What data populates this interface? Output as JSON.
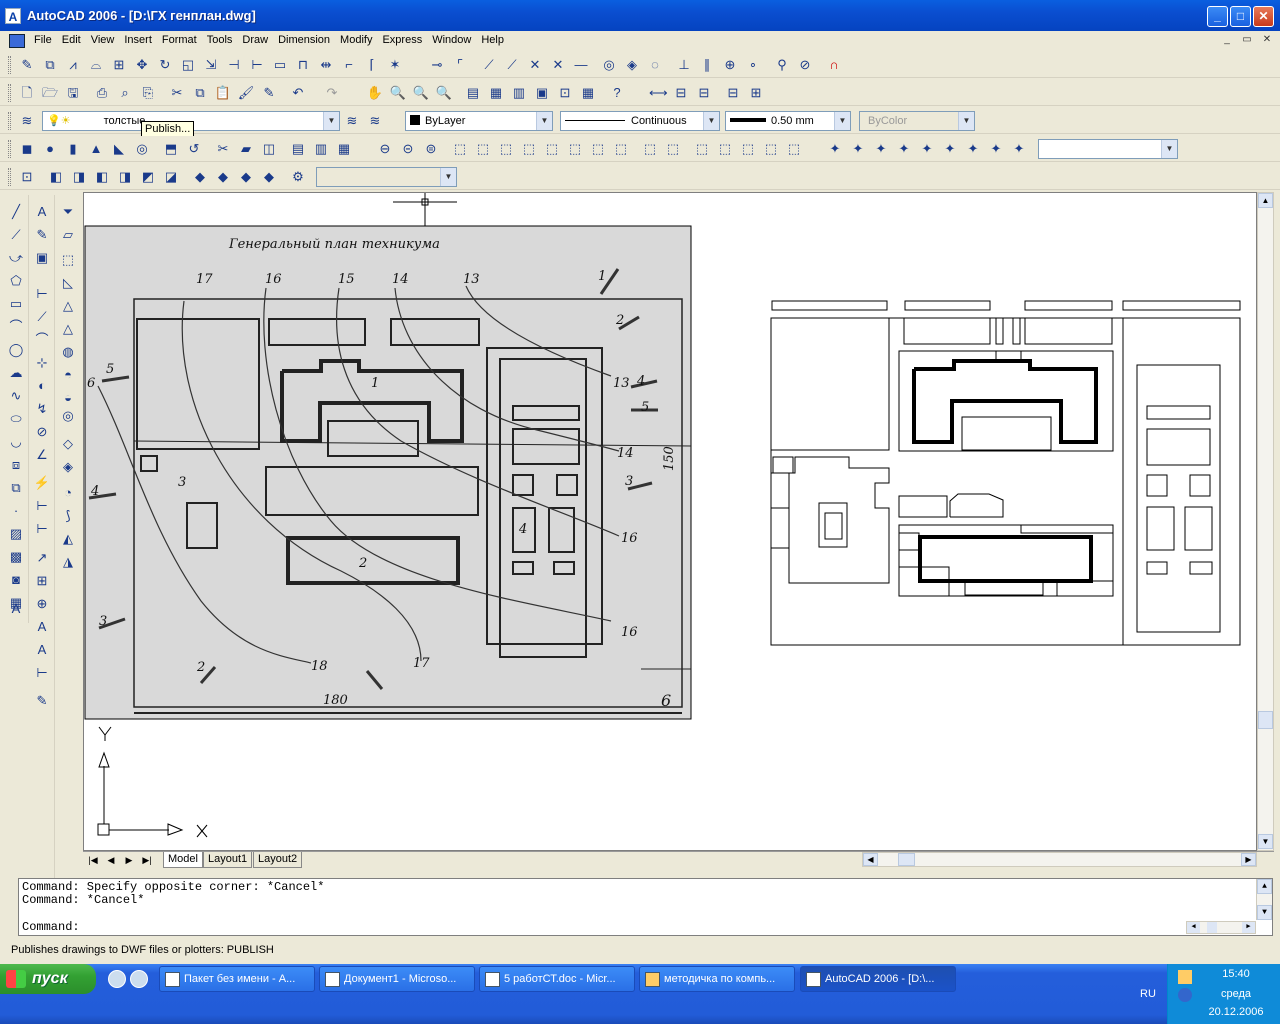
{
  "window": {
    "title": "AutoCAD 2006 - [D:\\ГХ генплан.dwg]",
    "min": "_",
    "max": "□",
    "close": "✕"
  },
  "menu": [
    "File",
    "Edit",
    "View",
    "Insert",
    "Format",
    "Tools",
    "Draw",
    "Dimension",
    "Modify",
    "Express",
    "Window",
    "Help"
  ],
  "properties": {
    "layer": "толстые",
    "color": "ByLayer",
    "linetype": "Continuous",
    "lineweight": "0.50 mm",
    "plotstyle": "ByColor"
  },
  "tooltip": "Publish...",
  "drawing": {
    "scan_title": "Генеральный план техникума",
    "labels": {
      "b1": "1",
      "b2": "2",
      "b3": "3",
      "b4": "4",
      "b6": "6",
      "dim180": "180",
      "dim150": "150"
    },
    "contours": [
      "17",
      "16",
      "15",
      "14",
      "13",
      "13",
      "14",
      "15",
      "16",
      "16",
      "17",
      "18"
    ],
    "wind": [
      "1",
      "2",
      "3",
      "4",
      "5",
      "5",
      "6",
      "3",
      "2",
      "3",
      "4"
    ]
  },
  "ucs": {
    "x": "X",
    "y": "Y"
  },
  "tabs": [
    "Model",
    "Layout1",
    "Layout2"
  ],
  "command": {
    "line1": "Command: Specify opposite corner: *Cancel*",
    "line2": "Command: *Cancel*",
    "prompt": "Command:"
  },
  "status": "Publishes drawings to DWF files or plotters:  PUBLISH",
  "taskbar": {
    "start": "пуск",
    "tasks": [
      "Пакет без имени - A...",
      "Документ1 - Microso...",
      "5 работСТ.doc - Micr...",
      "методичка по компь...",
      "AutoCAD 2006 - [D:\\..."
    ],
    "lang": "RU",
    "time": "15:40",
    "day": "среда",
    "date": "20.12.2006"
  },
  "colors": {
    "title": "#0a4ed0",
    "bg": "#ece9d8",
    "task": "#225cd8"
  }
}
